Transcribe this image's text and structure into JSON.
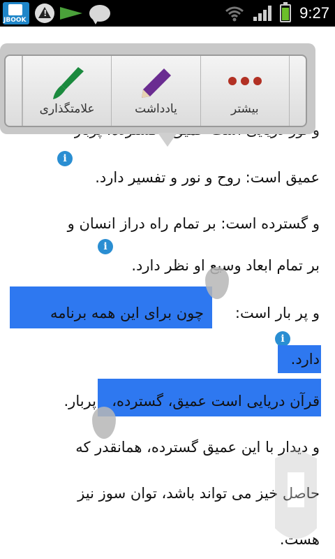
{
  "status_bar": {
    "app_badge": "JBOOK",
    "time": "9:27"
  },
  "toolbar": {
    "items": [
      {
        "label": "علامتگذاری",
        "icon": "brush-icon",
        "color": "#1b8a3e"
      },
      {
        "label": "یادداشت",
        "icon": "pencil-icon",
        "color": "#6a2c91"
      },
      {
        "label": "بیشتر",
        "icon": "more-icon",
        "color": "#b23124"
      }
    ]
  },
  "content": {
    "lines": [
      "عمیق است: روح و نور و تفسیر دارد.",
      "و گسترده است: بر تمام راه دراز انسان و",
      "بر تمام ابعاد وسیع او نظر دارد.",
      "و پر بار است:",
      "چون برای این همه برنامه",
      "دارد.",
      "قرآن دریایی است عمیق، گسترده،",
      "پربار.",
      "و دیدار با این عمیق گسترده، همانقدر که",
      "حاصل خیز می تواند باشد، توان سوز نیز",
      "هست."
    ],
    "info_marker": "i"
  },
  "colors": {
    "highlight": "#2e78f0",
    "info": "#2a8ed2"
  }
}
